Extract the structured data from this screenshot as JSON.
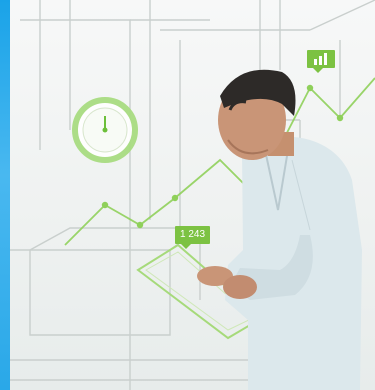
{
  "scene": {
    "bubble_number": "1 243",
    "colors": {
      "accent_green": "#7cc242",
      "side_bar_blue": "#1aa3e8",
      "sketch_line": "#c9cfcd"
    },
    "icons": [
      "gauge-icon",
      "bar-chart-icon",
      "clipboard-icon"
    ]
  }
}
